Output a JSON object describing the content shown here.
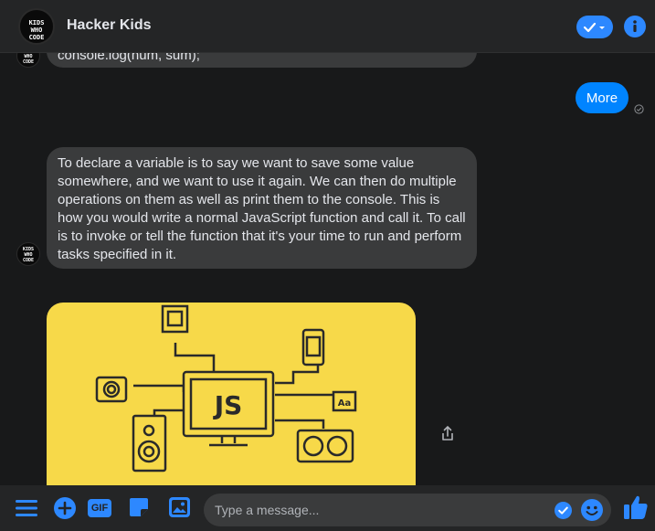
{
  "header": {
    "title": "Hacker Kids",
    "avatar_lines": [
      "KIDS",
      "WHO",
      "CODE"
    ]
  },
  "messages": {
    "partial_code": "console.log(num, sum);",
    "outgoing": "More",
    "explanation": "To declare a variable is to say we want to save some value somewhere, and we want to use it again. We can then do multiple operations on them as well as print them to the console. This is how you would write a normal JavaScript function and call it. To call is to invoke or tell the function that it's your time to run and perform tasks specified in it.",
    "image_label": "JS",
    "image_font_label": "Aa"
  },
  "composer": {
    "placeholder": "Type a message...",
    "gif_label": "GIF"
  },
  "colors": {
    "accent": "#2d88ff",
    "bubble_out": "#0084ff",
    "bubble_in": "#3a3b3c",
    "image_bg": "#f7d949"
  },
  "icons": [
    "check-icon",
    "info-icon",
    "seen-icon",
    "share-icon",
    "menu-icon",
    "plus-icon",
    "gif-icon",
    "sticker-icon",
    "image-icon",
    "emoji-icon",
    "like-icon"
  ]
}
